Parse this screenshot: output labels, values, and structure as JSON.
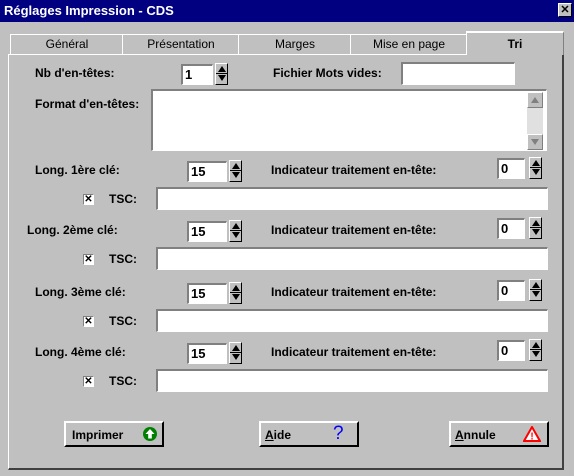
{
  "window": {
    "title": "Réglages Impression - CDS",
    "close_glyph": "✕"
  },
  "tabs": [
    {
      "label": "Général"
    },
    {
      "label": "Présentation"
    },
    {
      "label": "Marges"
    },
    {
      "label": "Mise en page"
    },
    {
      "label": "Tri",
      "active": true
    }
  ],
  "header": {
    "nb_label": "Nb d'en-têtes:",
    "nb_value": "1",
    "fichier_label": "Fichier Mots vides:",
    "fichier_value": "",
    "format_label": "Format d'en-têtes:",
    "format_value": ""
  },
  "keys": [
    {
      "long_label": "Long. 1ère clé:",
      "long_value": "15",
      "ind_label": "Indicateur traitement en-tête:",
      "ind_value": "0",
      "tsc_label": "TSC:",
      "tsc_checked": true,
      "tsc_value": ""
    },
    {
      "long_label": "Long. 2ème clé:",
      "long_value": "15",
      "ind_label": "Indicateur traitement en-tête:",
      "ind_value": "0",
      "tsc_label": "TSC:",
      "tsc_checked": true,
      "tsc_value": ""
    },
    {
      "long_label": "Long. 3ème clé:",
      "long_value": "15",
      "ind_label": "Indicateur traitement en-tête:",
      "ind_value": "0",
      "tsc_label": "TSC:",
      "tsc_checked": true,
      "tsc_value": ""
    },
    {
      "long_label": "Long. 4ème clé:",
      "long_value": "15",
      "ind_label": "Indicateur traitement en-tête:",
      "ind_value": "0",
      "tsc_label": "TSC:",
      "tsc_checked": true,
      "tsc_value": ""
    }
  ],
  "buttons": {
    "print_label": "Imprimer",
    "help_label_first": "A",
    "help_label_rest": "ide",
    "help_icon": "?",
    "cancel_label_first": "A",
    "cancel_label_rest": "nnule",
    "cancel_icon": "!"
  },
  "colors": {
    "titlebar": "#000080",
    "print_icon": "#008000",
    "help_icon": "#0000ff",
    "cancel_icon": "#ff0000"
  },
  "checkmark": "✕"
}
